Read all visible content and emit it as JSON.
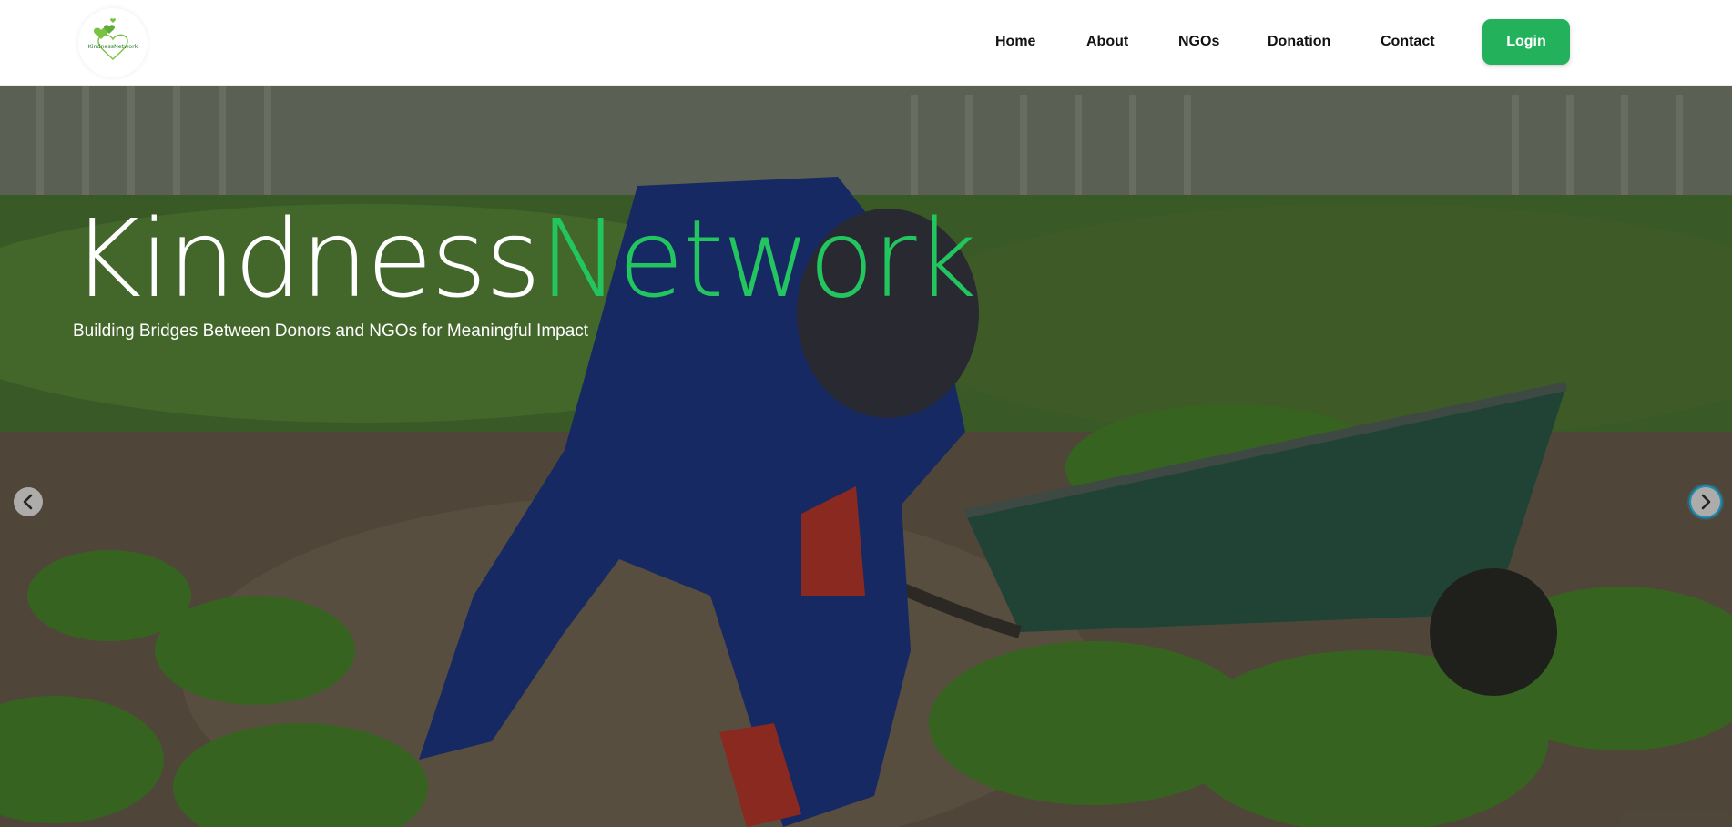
{
  "brand": {
    "logo_text": "KindnessNetwork",
    "primary_color": "#22c55e",
    "button_color": "#23b15c"
  },
  "nav": {
    "items": [
      {
        "label": "Home"
      },
      {
        "label": "About"
      },
      {
        "label": "NGOs"
      },
      {
        "label": "Donation"
      },
      {
        "label": "Contact"
      }
    ],
    "login_label": "Login"
  },
  "hero": {
    "title_part1": "Kindness",
    "title_part2": "Network",
    "subtitle": "Building Bridges Between Donors and NGOs for Meaningful Impact",
    "image_description_icon": "garden-photo",
    "prev_icon": "chevron-left-icon",
    "next_icon": "chevron-right-icon"
  }
}
